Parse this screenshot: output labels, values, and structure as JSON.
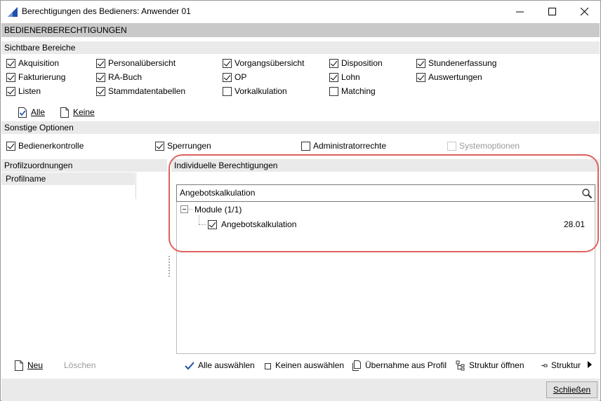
{
  "window": {
    "title": "Berechtigungen des Bedieners: Anwender 01",
    "header": "BEDIENERBERECHTIGUNGEN",
    "close_button": "Schließen"
  },
  "sichtbare": {
    "title": "Sichtbare Bereiche",
    "items": [
      {
        "label": "Akquisition",
        "checked": true
      },
      {
        "label": "Personalübersicht",
        "checked": true
      },
      {
        "label": "Vorgangsübersicht",
        "checked": true
      },
      {
        "label": "Disposition",
        "checked": true
      },
      {
        "label": "Stundenerfassung",
        "checked": true
      },
      {
        "label": "Fakturierung",
        "checked": true
      },
      {
        "label": "RA-Buch",
        "checked": true
      },
      {
        "label": "OP",
        "checked": true
      },
      {
        "label": "Lohn",
        "checked": true
      },
      {
        "label": "Auswertungen",
        "checked": true
      },
      {
        "label": "Listen",
        "checked": true
      },
      {
        "label": "Stammdatentabellen",
        "checked": true
      },
      {
        "label": "Vorkalkulation",
        "checked": false
      },
      {
        "label": "Matching",
        "checked": false
      }
    ],
    "all_label": "Alle",
    "none_label": "Keine"
  },
  "sonstige": {
    "title": "Sonstige Optionen",
    "items": [
      {
        "label": "Bedienerkontrolle",
        "checked": true
      },
      {
        "label": "Sperrungen",
        "checked": true
      },
      {
        "label": "Administratorrechte",
        "checked": false
      },
      {
        "label": "Systemoptionen",
        "checked": false,
        "disabled": true
      }
    ]
  },
  "profil": {
    "title": "Profilzuordnungen",
    "column": "Profilname",
    "new_label": "Neu",
    "delete_label": "Löschen"
  },
  "individuelle": {
    "title": "Individuelle Berechtigungen",
    "search_value": "Angebotskalkulation",
    "tree_root": "Module (1/1)",
    "tree_item": {
      "label": "Angebotskalkulation",
      "value": "28.01",
      "checked": true
    },
    "toolbar": {
      "select_all": "Alle auswählen",
      "select_none": "Keinen auswählen",
      "take_profile": "Übernahme aus Profil",
      "open_structure": "Struktur öffnen",
      "close_structure": "Struktur"
    }
  },
  "colors": {
    "accent": "#1f4fa8",
    "highlight": "#e06060"
  }
}
